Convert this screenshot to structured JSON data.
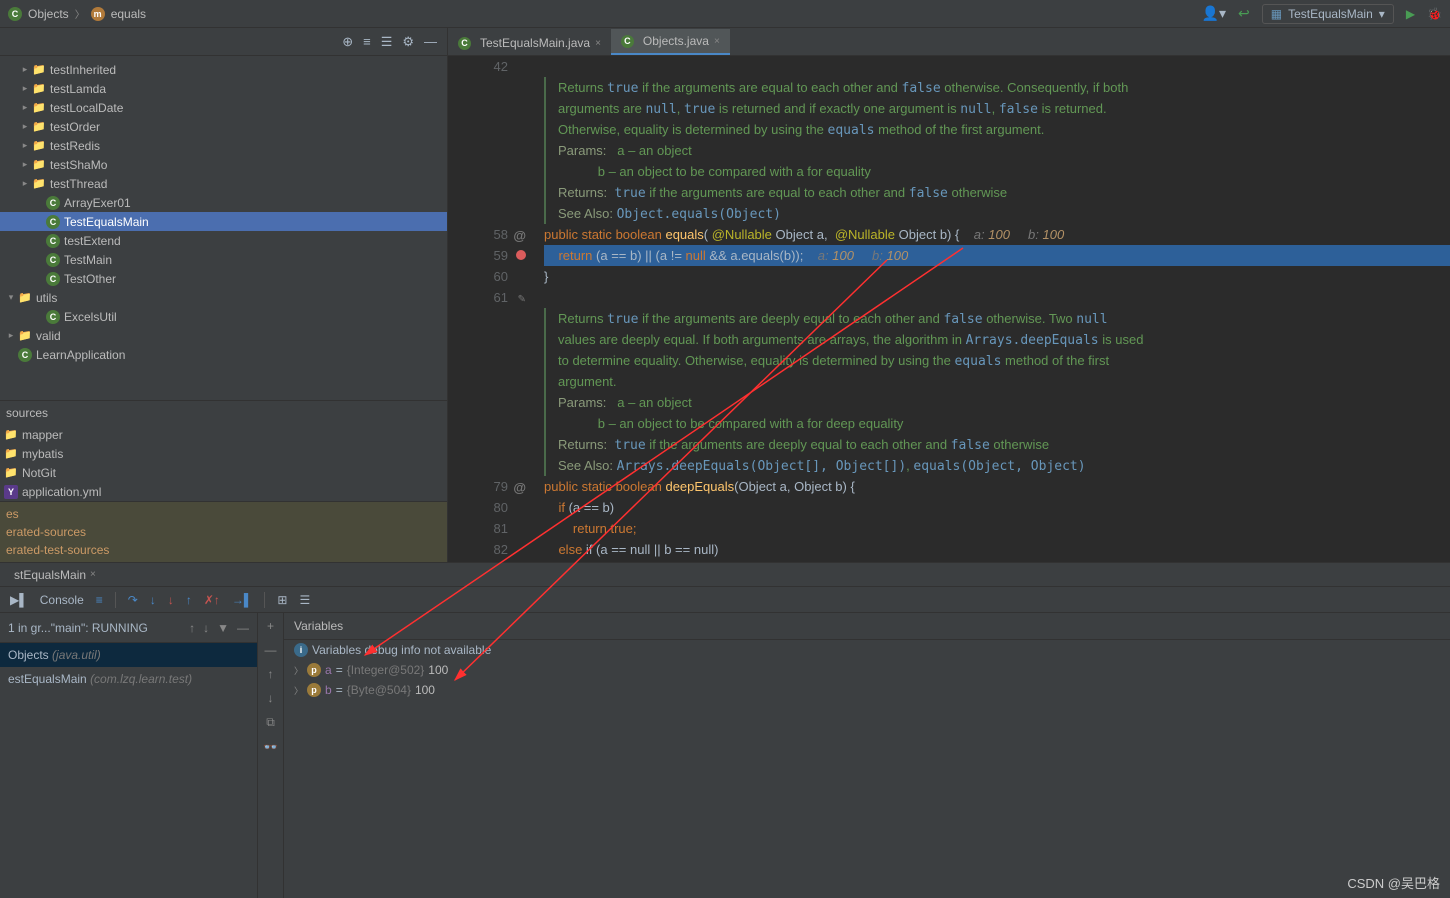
{
  "breadcrumb": {
    "cls": "Objects",
    "method": "equals"
  },
  "run_config": "TestEqualsMain",
  "tree": [
    {
      "type": "dir",
      "label": "testInherited",
      "indent": 1,
      "arrow": ">"
    },
    {
      "type": "dir",
      "label": "testLamda",
      "indent": 1,
      "arrow": ">"
    },
    {
      "type": "dir",
      "label": "testLocalDate",
      "indent": 1,
      "arrow": ">"
    },
    {
      "type": "dir",
      "label": "testOrder",
      "indent": 1,
      "arrow": ">"
    },
    {
      "type": "dir",
      "label": "testRedis",
      "indent": 1,
      "arrow": ">"
    },
    {
      "type": "dir",
      "label": "testShaMo",
      "indent": 1,
      "arrow": ">"
    },
    {
      "type": "dir",
      "label": "testThread",
      "indent": 1,
      "arrow": ">"
    },
    {
      "type": "cls",
      "label": "ArrayExer01",
      "indent": 2
    },
    {
      "type": "cls",
      "label": "TestEqualsMain",
      "indent": 2,
      "sel": true
    },
    {
      "type": "cls",
      "label": "testExtend",
      "indent": 2
    },
    {
      "type": "cls",
      "label": "TestMain",
      "indent": 2
    },
    {
      "type": "cls",
      "label": "TestOther",
      "indent": 2
    },
    {
      "type": "dir",
      "label": "utils",
      "indent": 0,
      "arrow": "v"
    },
    {
      "type": "cls",
      "label": "ExcelsUtil",
      "indent": 2
    },
    {
      "type": "dir",
      "label": "valid",
      "indent": 0,
      "arrow": ">"
    },
    {
      "type": "java",
      "label": "LearnApplication",
      "indent": 0
    }
  ],
  "sources": {
    "header": "sources",
    "items": [
      "mapper",
      "mybatis",
      "NotGit",
      "application.yml"
    ],
    "footer": [
      "es",
      "erated-sources",
      "erated-test-sources"
    ]
  },
  "editor_tabs": [
    {
      "icon": "cls",
      "label": "TestEqualsMain.java",
      "active": false
    },
    {
      "icon": "cls",
      "label": "Objects.java",
      "active": true
    }
  ],
  "code": {
    "doc1": {
      "line1_a": "Returns ",
      "line1_b": "true",
      "line1_c": " if the arguments are equal to each other and ",
      "line1_d": "false",
      "line1_e": " otherwise. Consequently, if both",
      "line2_a": "arguments are ",
      "line2_b": "null",
      "line2_c": ", ",
      "line2_d": "true",
      "line2_e": " is returned and if exactly one argument is ",
      "line2_f": "null",
      "line2_g": ", ",
      "line2_h": "false",
      "line2_i": " is returned.",
      "line3_a": "Otherwise, equality is determined by using the ",
      "line3_b": "equals",
      "line3_c": " method of the first argument.",
      "params_label": "Params:",
      "param_a": "a – an object",
      "param_b": "b – an object to be compared with a for equality",
      "returns_label": "Returns:",
      "returns_a": "true",
      "returns_b": " if the arguments are equal to each other and ",
      "returns_c": "false",
      "returns_d": " otherwise",
      "seealso_label": "See Also:",
      "seealso_link": "Object.equals(Object)"
    },
    "l58": {
      "kw_public": "public",
      "kw_static": "static",
      "kw_bool": "boolean",
      "method": "equals",
      "ann": "@Nullable",
      "cls": "Object",
      "p1": "a",
      "p2": "b",
      "hint_a": "a: ",
      "hint_av": "100",
      "hint_b": "b: ",
      "hint_bv": "100"
    },
    "l59": {
      "kw_return": "return",
      "body": "(a == b) || (a != ",
      "kw_null": "null",
      "body2": " && a.equals(b));",
      "hint_a": "a: ",
      "hint_av": "100",
      "hint_b": "b: ",
      "hint_bv": "100"
    },
    "l60": "}",
    "doc2": {
      "line1_a": "Returns ",
      "line1_b": "true",
      "line1_c": " if the arguments are deeply equal to each other and ",
      "line1_d": "false",
      "line1_e": " otherwise. Two ",
      "line1_f": "null",
      "line2_a": "values are deeply equal. If both arguments are arrays, the algorithm in ",
      "line2_b": "Arrays.deepEquals",
      "line2_c": " is used",
      "line3_a": "to determine equality. Otherwise, equality is determined by using the ",
      "line3_b": "equals",
      "line3_c": " method of the first",
      "line4": "argument.",
      "param_a": "a – an object",
      "param_b": "b – an object to be compared with a for deep equality",
      "returns_a": "true",
      "returns_b": " if the arguments are deeply equal to each other and ",
      "returns_c": "false",
      "returns_d": " otherwise",
      "seealso_a": "Arrays.deepEquals(Object[], Object[])",
      "seealso_b": "equals(Object, Object)"
    },
    "l79": {
      "method": "deepEquals",
      "sig": "(Object a, Object b) {"
    },
    "l80": "if (a == b)",
    "l81": {
      "kw": "return",
      "body": " true;"
    },
    "l82": {
      "kw": "else",
      "body": " if (a == null || b == null)"
    }
  },
  "line_numbers": {
    "l42": "42",
    "l58": "58",
    "l59": "59",
    "l60": "60",
    "l61": "61",
    "l79": "79",
    "l80": "80",
    "l81": "81",
    "l82": "82"
  },
  "debug": {
    "tab": "stEqualsMain",
    "console_label": "Console",
    "thread": "1 in gr...\"main\": RUNNING",
    "frame1": {
      "name": "Objects",
      "pkg": "(java.util)"
    },
    "frame2": {
      "name": "estEqualsMain",
      "pkg": "(com.lzq.learn.test)"
    },
    "vars_header": "Variables",
    "info": "Variables debug info not available",
    "var_a": {
      "name": "a",
      "eq": " = ",
      "type": "{Integer@502}",
      "val": " 100"
    },
    "var_b": {
      "name": "b",
      "eq": " = ",
      "type": "{Byte@504}",
      "val": " 100"
    }
  },
  "watermark": "CSDN @吴巴格"
}
